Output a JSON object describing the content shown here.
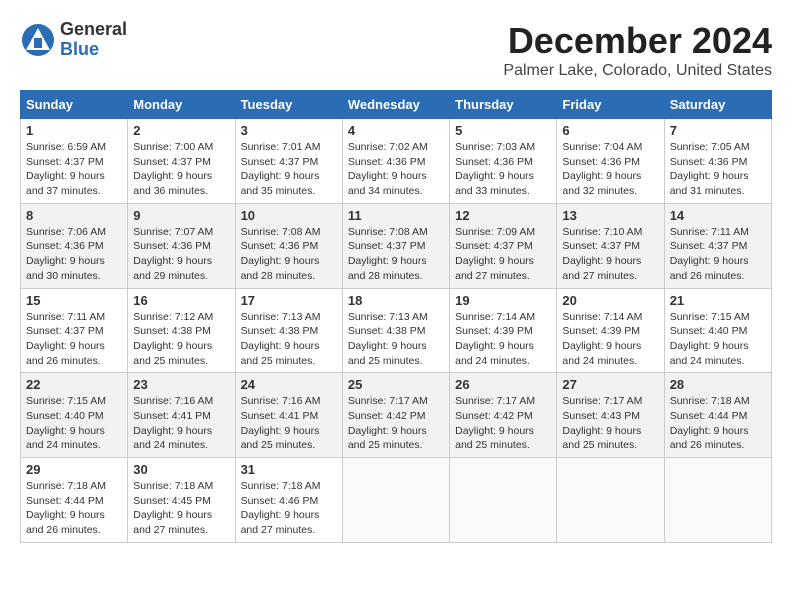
{
  "logo": {
    "general": "General",
    "blue": "Blue"
  },
  "title": "December 2024",
  "location": "Palmer Lake, Colorado, United States",
  "days_of_week": [
    "Sunday",
    "Monday",
    "Tuesday",
    "Wednesday",
    "Thursday",
    "Friday",
    "Saturday"
  ],
  "weeks": [
    [
      {
        "day": "1",
        "sunrise": "6:59 AM",
        "sunset": "4:37 PM",
        "daylight": "9 hours and 37 minutes."
      },
      {
        "day": "2",
        "sunrise": "7:00 AM",
        "sunset": "4:37 PM",
        "daylight": "9 hours and 36 minutes."
      },
      {
        "day": "3",
        "sunrise": "7:01 AM",
        "sunset": "4:37 PM",
        "daylight": "9 hours and 35 minutes."
      },
      {
        "day": "4",
        "sunrise": "7:02 AM",
        "sunset": "4:36 PM",
        "daylight": "9 hours and 34 minutes."
      },
      {
        "day": "5",
        "sunrise": "7:03 AM",
        "sunset": "4:36 PM",
        "daylight": "9 hours and 33 minutes."
      },
      {
        "day": "6",
        "sunrise": "7:04 AM",
        "sunset": "4:36 PM",
        "daylight": "9 hours and 32 minutes."
      },
      {
        "day": "7",
        "sunrise": "7:05 AM",
        "sunset": "4:36 PM",
        "daylight": "9 hours and 31 minutes."
      }
    ],
    [
      {
        "day": "8",
        "sunrise": "7:06 AM",
        "sunset": "4:36 PM",
        "daylight": "9 hours and 30 minutes."
      },
      {
        "day": "9",
        "sunrise": "7:07 AM",
        "sunset": "4:36 PM",
        "daylight": "9 hours and 29 minutes."
      },
      {
        "day": "10",
        "sunrise": "7:08 AM",
        "sunset": "4:36 PM",
        "daylight": "9 hours and 28 minutes."
      },
      {
        "day": "11",
        "sunrise": "7:08 AM",
        "sunset": "4:37 PM",
        "daylight": "9 hours and 28 minutes."
      },
      {
        "day": "12",
        "sunrise": "7:09 AM",
        "sunset": "4:37 PM",
        "daylight": "9 hours and 27 minutes."
      },
      {
        "day": "13",
        "sunrise": "7:10 AM",
        "sunset": "4:37 PM",
        "daylight": "9 hours and 27 minutes."
      },
      {
        "day": "14",
        "sunrise": "7:11 AM",
        "sunset": "4:37 PM",
        "daylight": "9 hours and 26 minutes."
      }
    ],
    [
      {
        "day": "15",
        "sunrise": "7:11 AM",
        "sunset": "4:37 PM",
        "daylight": "9 hours and 26 minutes."
      },
      {
        "day": "16",
        "sunrise": "7:12 AM",
        "sunset": "4:38 PM",
        "daylight": "9 hours and 25 minutes."
      },
      {
        "day": "17",
        "sunrise": "7:13 AM",
        "sunset": "4:38 PM",
        "daylight": "9 hours and 25 minutes."
      },
      {
        "day": "18",
        "sunrise": "7:13 AM",
        "sunset": "4:38 PM",
        "daylight": "9 hours and 25 minutes."
      },
      {
        "day": "19",
        "sunrise": "7:14 AM",
        "sunset": "4:39 PM",
        "daylight": "9 hours and 24 minutes."
      },
      {
        "day": "20",
        "sunrise": "7:14 AM",
        "sunset": "4:39 PM",
        "daylight": "9 hours and 24 minutes."
      },
      {
        "day": "21",
        "sunrise": "7:15 AM",
        "sunset": "4:40 PM",
        "daylight": "9 hours and 24 minutes."
      }
    ],
    [
      {
        "day": "22",
        "sunrise": "7:15 AM",
        "sunset": "4:40 PM",
        "daylight": "9 hours and 24 minutes."
      },
      {
        "day": "23",
        "sunrise": "7:16 AM",
        "sunset": "4:41 PM",
        "daylight": "9 hours and 24 minutes."
      },
      {
        "day": "24",
        "sunrise": "7:16 AM",
        "sunset": "4:41 PM",
        "daylight": "9 hours and 25 minutes."
      },
      {
        "day": "25",
        "sunrise": "7:17 AM",
        "sunset": "4:42 PM",
        "daylight": "9 hours and 25 minutes."
      },
      {
        "day": "26",
        "sunrise": "7:17 AM",
        "sunset": "4:42 PM",
        "daylight": "9 hours and 25 minutes."
      },
      {
        "day": "27",
        "sunrise": "7:17 AM",
        "sunset": "4:43 PM",
        "daylight": "9 hours and 25 minutes."
      },
      {
        "day": "28",
        "sunrise": "7:18 AM",
        "sunset": "4:44 PM",
        "daylight": "9 hours and 26 minutes."
      }
    ],
    [
      {
        "day": "29",
        "sunrise": "7:18 AM",
        "sunset": "4:44 PM",
        "daylight": "9 hours and 26 minutes."
      },
      {
        "day": "30",
        "sunrise": "7:18 AM",
        "sunset": "4:45 PM",
        "daylight": "9 hours and 27 minutes."
      },
      {
        "day": "31",
        "sunrise": "7:18 AM",
        "sunset": "4:46 PM",
        "daylight": "9 hours and 27 minutes."
      },
      null,
      null,
      null,
      null
    ]
  ],
  "labels": {
    "sunrise": "Sunrise:",
    "sunset": "Sunset:",
    "daylight": "Daylight:"
  }
}
